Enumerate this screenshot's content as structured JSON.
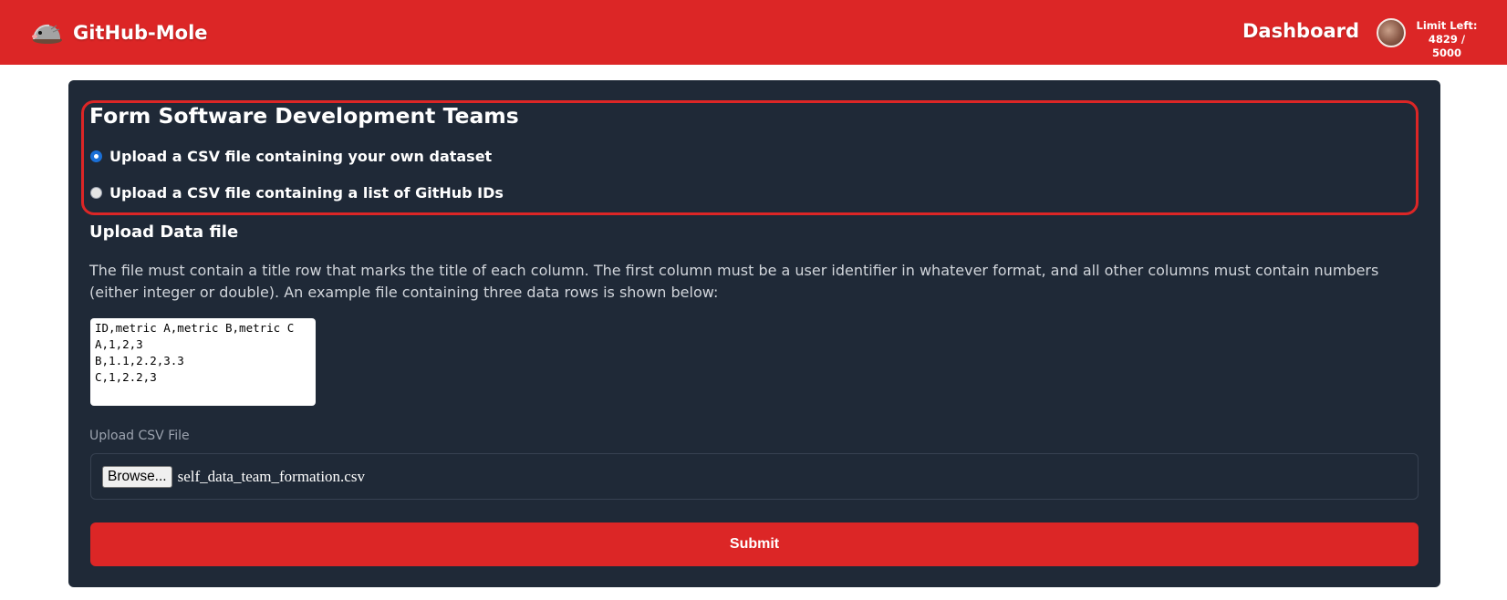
{
  "header": {
    "brand_name": "GitHub-Mole",
    "brand_icon": "mole-icon",
    "nav_dashboard": "Dashboard",
    "avatar_icon": "user-avatar",
    "limit_label": "Limit Left:",
    "limit_value": "4829 / 5000",
    "bar_color": "#dc2626"
  },
  "form": {
    "title": "Form Software Development Teams",
    "options": [
      {
        "label": "Upload a CSV file containing your own dataset",
        "checked": true
      },
      {
        "label": "Upload a CSV file containing a list of GitHub IDs",
        "checked": false
      }
    ],
    "section_title": "Upload Data file",
    "description": "The file must contain a title row that marks the title of each column. The first column must be a user identifier in whatever format, and all other columns must contain numbers (either integer or double). An example file containing three data rows is shown below:",
    "example_lines": [
      "ID,metric A,metric B,metric C",
      "A,1,2,3",
      "B,1.1,2.2,3.3",
      "C,1,2.2,3"
    ],
    "upload_label": "Upload CSV File",
    "browse_label": "Browse...",
    "file_name": "self_data_team_formation.csv",
    "submit_label": "Submit",
    "card_color": "#1f2937",
    "accent_color": "#dc2626"
  }
}
